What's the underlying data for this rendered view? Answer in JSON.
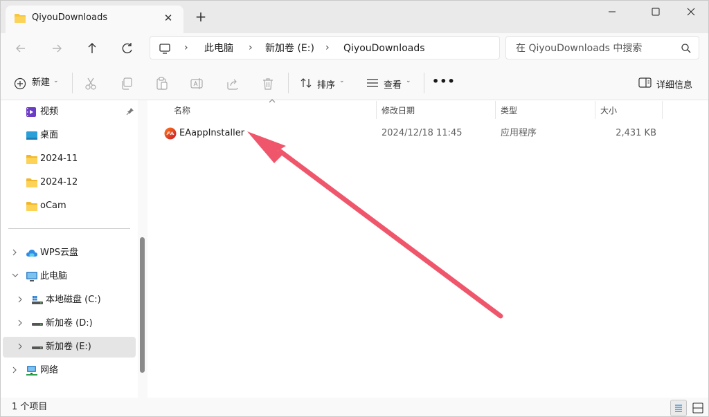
{
  "window": {
    "tab_title": "QiyouDownloads",
    "tab_close": "✕",
    "new_tab": "+"
  },
  "address": {
    "crumbs": [
      "此电脑",
      "新加卷 (E:)",
      "QiyouDownloads"
    ],
    "separator": "›"
  },
  "search": {
    "placeholder": "在 QiyouDownloads 中搜索"
  },
  "toolbar": {
    "new_label": "新建",
    "sort_label": "排序",
    "view_label": "查看",
    "more_label": "•••",
    "details_label": "详细信息",
    "caret": "⌄"
  },
  "sidebar": {
    "quick_access": [
      {
        "label": "视频",
        "icon": "video-folder-icon",
        "pinned": true
      },
      {
        "label": "桌面",
        "icon": "desktop-folder-icon"
      },
      {
        "label": "2024-11",
        "icon": "folder-icon"
      },
      {
        "label": "2024-12",
        "icon": "folder-icon"
      },
      {
        "label": "oCam",
        "icon": "folder-icon"
      }
    ],
    "tree": [
      {
        "label": "WPS云盘",
        "icon": "cloud-icon",
        "expanded": false
      },
      {
        "label": "此电脑",
        "icon": "computer-icon",
        "expanded": true
      },
      {
        "label": "本地磁盘 (C:)",
        "icon": "system-drive-icon",
        "expanded": false
      },
      {
        "label": "新加卷 (D:)",
        "icon": "drive-icon",
        "expanded": false
      },
      {
        "label": "新加卷 (E:)",
        "icon": "drive-icon",
        "expanded": false,
        "selected": true
      },
      {
        "label": "网络",
        "icon": "network-icon",
        "expanded": false
      }
    ]
  },
  "columns": [
    "名称",
    "修改日期",
    "类型",
    "大小"
  ],
  "files": [
    {
      "name": "EAappInstaller",
      "date": "2024/12/18 11:45",
      "type": "应用程序",
      "size": "2,431 KB",
      "icon": "ea-app-icon"
    }
  ],
  "status": {
    "item_count": "1 个项目"
  },
  "colors": {
    "annotation_arrow": "#f0566b",
    "folder": "#f8c63d",
    "accent": "#0067c0"
  }
}
